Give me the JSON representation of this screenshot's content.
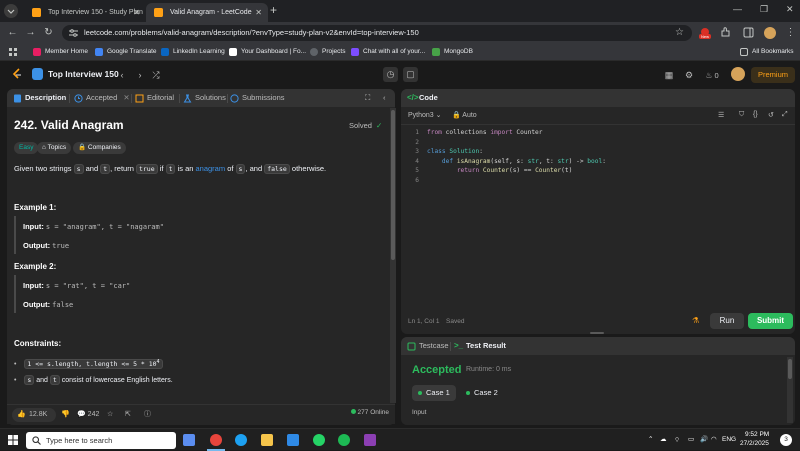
{
  "browser": {
    "tabs": [
      {
        "title": "Top Interview 150 - Study Plan",
        "active": false
      },
      {
        "title": "Valid Anagram - LeetCode",
        "active": true
      }
    ],
    "url": "leetcode.com/problems/valid-anagram/description/?envType=study-plan-v2&envId=top-interview-150",
    "bookmarks": [
      {
        "label": "Member Home",
        "color": "#e91e63"
      },
      {
        "label": "Google Translate",
        "color": "#4285f4"
      },
      {
        "label": "LinkedIn Learning",
        "color": "#0a66c2"
      },
      {
        "label": "Your Dashboard | Fo...",
        "color": "#ffffff"
      },
      {
        "label": "Projects",
        "color": "#5f6368"
      },
      {
        "label": "Chat with all of your...",
        "color": "#7c4dff"
      },
      {
        "label": "MongoDB",
        "color": "#47a248"
      }
    ],
    "all_bookmarks": "All Bookmarks",
    "new_badge": "New"
  },
  "lcnav": {
    "list_title": "Top Interview 150",
    "streak": "0",
    "premium": "Premium"
  },
  "left_panel": {
    "tabs": [
      "Description",
      "Accepted",
      "Editorial",
      "Solutions",
      "Submissions"
    ],
    "problem_title": "242. Valid Anagram",
    "solved_label": "Solved",
    "tags": {
      "difficulty": "Easy",
      "topics": "Topics",
      "companies": "Companies"
    },
    "description": {
      "p1": "Given two strings ",
      "s": "s",
      "p2": " and ",
      "t": "t",
      "p3": ", return ",
      "true": "true",
      "p4": " if ",
      "t2": "t",
      "p5": " is an ",
      "anagram": "anagram",
      "p6": " of ",
      "s2": "s",
      "p7": ", and ",
      "false": "false",
      "p8": " otherwise."
    },
    "examples": [
      {
        "heading": "Example 1:",
        "input_label": "Input:",
        "input": "s = \"anagram\", t = \"nagaram\"",
        "output_label": "Output:",
        "output": "true"
      },
      {
        "heading": "Example 2:",
        "input_label": "Input:",
        "input": "s = \"rat\", t = \"car\"",
        "output_label": "Output:",
        "output": "false"
      }
    ],
    "constraints_heading": "Constraints:",
    "constraints": [
      {
        "code": "1 <= s.length, t.length <= 5 * 10",
        "sup": "4"
      },
      {
        "pre": "",
        "code_a": "s",
        "mid": " and ",
        "code_b": "t",
        "post": " consist of lowercase English letters."
      }
    ],
    "footer": {
      "likes": "12.8K",
      "comments": "242",
      "online": "277 Online"
    }
  },
  "code_panel": {
    "title": "Code",
    "language": "Python3",
    "mode": "Auto",
    "lines": [
      {
        "n": "1",
        "tokens": [
          [
            "kw",
            "from"
          ],
          [
            "txt",
            " collections "
          ],
          [
            "kw",
            "import"
          ],
          [
            "txt",
            " Counter"
          ]
        ]
      },
      {
        "n": "2",
        "tokens": []
      },
      {
        "n": "3",
        "tokens": [
          [
            "kwb",
            "class"
          ],
          [
            "txt",
            " "
          ],
          [
            "cls",
            "Solution"
          ],
          [
            "txt",
            ":"
          ]
        ]
      },
      {
        "n": "4",
        "tokens": [
          [
            "txt",
            "    "
          ],
          [
            "kwb",
            "def"
          ],
          [
            "txt",
            " "
          ],
          [
            "fn",
            "isAnagram"
          ],
          [
            "txt",
            "(self, s: "
          ],
          [
            "cls",
            "str"
          ],
          [
            "txt",
            ", t: "
          ],
          [
            "cls",
            "str"
          ],
          [
            "txt",
            ") -> "
          ],
          [
            "cls",
            "bool"
          ],
          [
            "txt",
            ":"
          ]
        ]
      },
      {
        "n": "5",
        "tokens": [
          [
            "txt",
            "        "
          ],
          [
            "kw",
            "return"
          ],
          [
            "txt",
            " "
          ],
          [
            "fn",
            "Counter"
          ],
          [
            "txt",
            "(s) == "
          ],
          [
            "fn",
            "Counter"
          ],
          [
            "txt",
            "(t)"
          ]
        ]
      },
      {
        "n": "6",
        "tokens": []
      }
    ],
    "cursor": "Ln 1, Col 1",
    "saved": "Saved",
    "run": "Run",
    "submit": "Submit"
  },
  "result_panel": {
    "tabs": [
      "Testcase",
      "Test Result"
    ],
    "status": "Accepted",
    "runtime": "Runtime: 0 ms",
    "cases": [
      "Case 1",
      "Case 2"
    ],
    "input_label": "Input"
  },
  "taskbar": {
    "search_placeholder": "Type here to search",
    "lang": "ENG",
    "time": "9:52 PM",
    "date": "27/2/2025",
    "notif_count": "3"
  },
  "colors": {
    "accent_green": "#2cbb5d",
    "easy": "#00b8a3",
    "premium": "#ffa116",
    "link": "#3c91e6"
  }
}
